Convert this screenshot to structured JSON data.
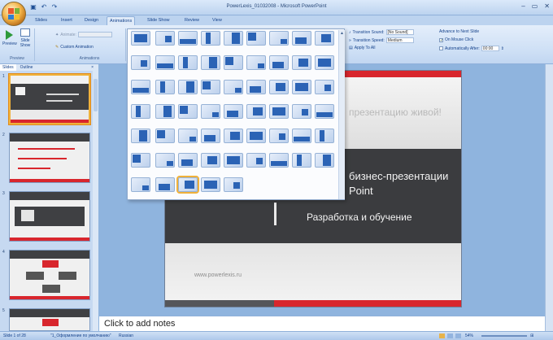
{
  "app": {
    "title": "PowerLexis_01032008 - Microsoft PowerPoint",
    "window_controls": [
      "–",
      "▭",
      "✕"
    ]
  },
  "ribbon_tabs": [
    "Slides",
    "Insert",
    "Design",
    "Animations",
    "Slide Show",
    "Review",
    "View"
  ],
  "active_tab": "Animations",
  "ribbon": {
    "preview_label": "Preview",
    "preview_group": "Preview",
    "slide_show_label": "Slide Show",
    "animate_label": "Animate:",
    "custom_animation_label": "Custom Animation",
    "animations_group": "Animations",
    "transition_sound_label": "Transition Sound:",
    "transition_sound_value": "[No Sound]",
    "transition_speed_label": "Transition Speed:",
    "transition_speed_value": "Medium",
    "apply_to_all_label": "Apply To All",
    "advance_label": "Advance to Next Slide",
    "on_mouse_click_label": "On Mouse Click",
    "automatically_after_label": "Automatically After:",
    "automatically_after_value": "00:00"
  },
  "panel": {
    "tabs": [
      "Slides",
      "Outline"
    ],
    "close": "×",
    "slide_numbers": [
      "1",
      "2",
      "3",
      "4",
      "5"
    ]
  },
  "slide": {
    "line1": "презентацию живой!",
    "line2": "бизнес-презентации",
    "line3": "Point",
    "line4": "Разработка и обучение",
    "url": "www.powerlexis.ru"
  },
  "notes": {
    "placeholder": "Click to add notes"
  },
  "status": {
    "slide_info": "Slide 1 of 28",
    "theme": "\"1_Оформление по умолчанию\"",
    "language": "Russian",
    "zoom": "54%"
  },
  "colors": {
    "accent_red": "#d8262d",
    "slide_dark": "#3b3c3f",
    "ribbon_blue": "#15428b",
    "selection_orange": "#f0b13a"
  }
}
